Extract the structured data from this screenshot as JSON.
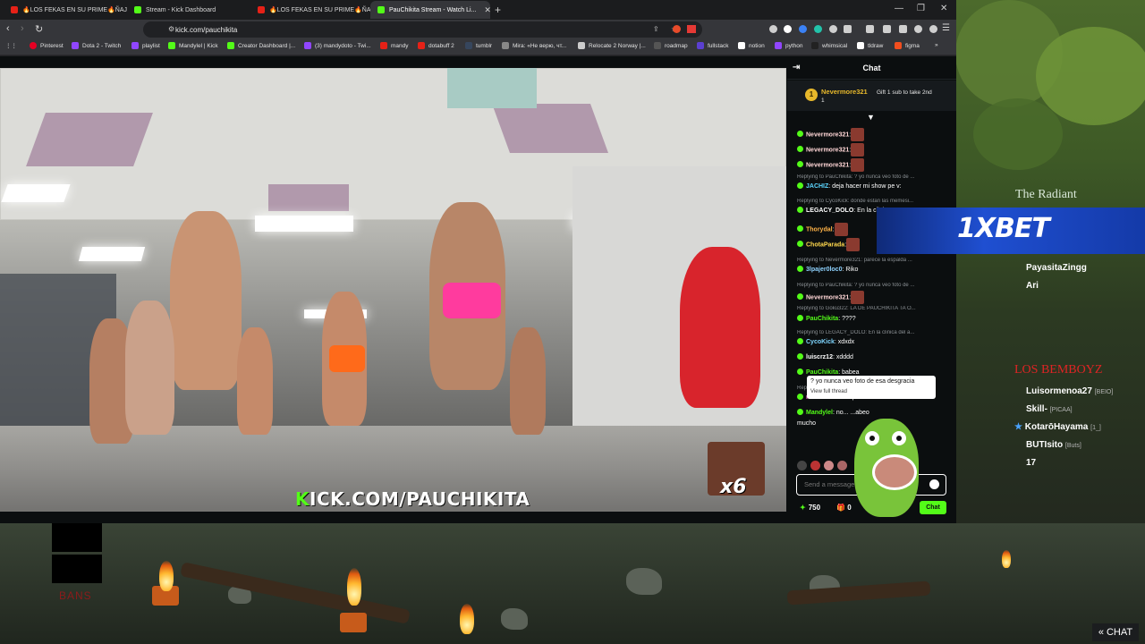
{
  "browser": {
    "tabs": [
      {
        "label": "🔥LOS FEKAS EN SU PRIME🔥ÑAJAS",
        "active": false,
        "favicon_color": "#e62117"
      },
      {
        "label": "Stream - Kick Dashboard",
        "active": false,
        "favicon_color": "#53fc18"
      },
      {
        "label": "🔥LOS FEKAS EN SU PRIME🔥ÑAJAS",
        "active": false,
        "favicon_color": "#e62117"
      },
      {
        "label": "PauChikita Stream - Watch Li...",
        "active": true,
        "favicon_color": "#53fc18"
      }
    ],
    "new_tab_icon": "plus-icon",
    "url": "kick.com/pauchikita",
    "bookmarks": [
      {
        "label": "Pinterest",
        "color": "#e60023"
      },
      {
        "label": "Dota 2 - Twitch",
        "color": "#9146ff"
      },
      {
        "label": "playlist",
        "color": "#9146ff"
      },
      {
        "label": "Mandylel | Kick",
        "color": "#53fc18"
      },
      {
        "label": "Creator Dashboard |...",
        "color": "#53fc18"
      },
      {
        "label": "(3) mandydoto - Twi...",
        "color": "#9146ff"
      },
      {
        "label": "mandy",
        "color": "#e62117"
      },
      {
        "label": "dotabuff 2",
        "color": "#e62117"
      },
      {
        "label": "tumblr",
        "color": "#36465d"
      },
      {
        "label": "Mira: «Не верю, чт...",
        "color": "#888888"
      },
      {
        "label": "Relocate 2 Norway |...",
        "color": "#cccccc"
      },
      {
        "label": "roadmap",
        "color": "#222222"
      },
      {
        "label": "fullstack",
        "color": "#5b3fd1"
      },
      {
        "label": "notion",
        "color": "#ffffff"
      },
      {
        "label": "python",
        "color": "#9146ff"
      },
      {
        "label": "whimsical",
        "color": "#222222"
      },
      {
        "label": "tldraw",
        "color": "#ffffff"
      },
      {
        "label": "figma",
        "color": "#f24e1e"
      }
    ]
  },
  "video": {
    "watermark_brand": "K",
    "watermark_text": "ICK.COM/PAUCHIKITA",
    "overlay_multiplier": "x6"
  },
  "chat": {
    "title": "Chat",
    "pinned": {
      "rank": "1",
      "user": "Nevermore321",
      "count": "1",
      "gift_text": "Gift 1 sub to take 2nd"
    },
    "messages": [
      {
        "type": "msg",
        "user": "Nevermore321",
        "color": "#ffd6d6",
        "text": ":"
      },
      {
        "type": "msg",
        "user": "Nevermore321",
        "color": "#ffd6d6",
        "text": ":"
      },
      {
        "type": "msg",
        "user": "Nevermore321",
        "color": "#ffd6d6",
        "text": ":"
      },
      {
        "type": "reply",
        "text": "Replying to PauChikita: ? yo nunca veo foto de ..."
      },
      {
        "type": "msg",
        "user": "JACHIZ",
        "color": "#5cd6ff",
        "text": ": deja hacer mi show pe v:"
      },
      {
        "type": "reply",
        "text": "Replying to CycoKick: donde estan las memesi..."
      },
      {
        "type": "msg",
        "user": "LEGACY_DOLO",
        "color": "#ffffff",
        "text": ": En la clini..."
      },
      {
        "type": "msg",
        "user": "Thorydal",
        "color": "#ffb347",
        "text": ":"
      },
      {
        "type": "msg",
        "user": "ChotaParada",
        "color": "#ffd84d",
        "text": ":"
      },
      {
        "type": "reply",
        "text": "Replying to Nevermore321: parece la espalda ..."
      },
      {
        "type": "msg",
        "user": "3lpajer0loc0",
        "color": "#8fd3ff",
        "text": ": Riko"
      },
      {
        "type": "reply",
        "text": "Replying to PauChikita: ? yo nunca veo foto de ..."
      },
      {
        "type": "msg",
        "user": "Nevermore321",
        "color": "#ffd6d6",
        "text": ":"
      },
      {
        "type": "reply",
        "text": "Replying to Goku322: LA DE PAUCHIKITA TA O..."
      },
      {
        "type": "msg",
        "user": "PauChikita",
        "color": "#53fc18",
        "text": ": ????"
      },
      {
        "type": "reply",
        "text": "Replying to LEGACY_DOLO: En la clinica del a..."
      },
      {
        "type": "msg",
        "user": "CycoKick",
        "color": "#7fd6ff",
        "text": ": xdxdx"
      },
      {
        "type": "msg",
        "user": "luiscrz12",
        "color": "#ffffff",
        "text": ": xdddd"
      },
      {
        "type": "msg",
        "user": "PauChikita",
        "color": "#53fc18",
        "text": ": babea"
      },
      {
        "type": "reply",
        "text": "Replying to PauChikita: ? yo nunca veo foto de ..."
      },
      {
        "type": "msg",
        "user": "rockloko",
        "color": "#ff6ad5",
        "text": ": si me pone... ...razoncito"
      },
      {
        "type": "msg",
        "user": "Mandylel",
        "color": "#53fc18",
        "text": ": no... ...abeo"
      },
      {
        "type": "msg",
        "user": "",
        "color": "#ffffff",
        "text": "mucho"
      }
    ],
    "tooltip": {
      "text": "? yo nunca veo foto de esa desgracia",
      "link": "View full thread"
    },
    "input_placeholder": "Send a message",
    "points": "750",
    "gift_count": "0",
    "send_label": "Chat"
  },
  "sponsor": {
    "text": "1XBET"
  },
  "dota_overlay": {
    "radiant_title": "The Radiant",
    "radiant_players": [
      {
        "name": "PayasitaZingg",
        "tag": ""
      },
      {
        "name": "Ari",
        "tag": ""
      }
    ],
    "dire_title": "LOS BEMBOYZ",
    "dire_players": [
      {
        "name": "Luisormenoa27",
        "tag": "[BEIO]"
      },
      {
        "name": "Skill-",
        "tag": "[PICAA]"
      },
      {
        "name": "KotarōHayama",
        "tag": "[1_]"
      },
      {
        "name": "BUTIsito",
        "tag": "[Buts]"
      },
      {
        "name": "17",
        "tag": ""
      }
    ],
    "bans_label": "BANS",
    "chat_toggle": "CHAT"
  }
}
